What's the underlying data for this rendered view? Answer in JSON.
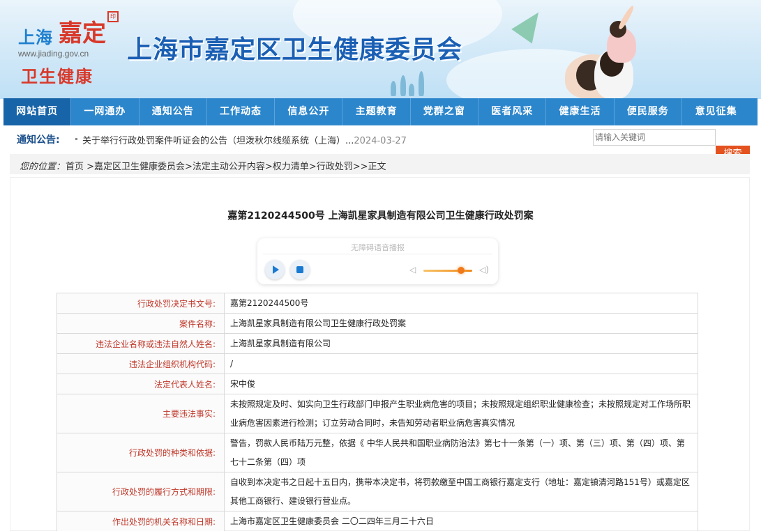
{
  "header": {
    "logo_shanghai": "上海",
    "logo_jiading": "嘉定",
    "logo_url": "www.jiading.gov.cn",
    "logo_health": "卫生健康",
    "site_title": "上海市嘉定区卫生健康委员会"
  },
  "nav": {
    "items": [
      "网站首页",
      "一网通办",
      "通知公告",
      "工作动态",
      "信息公开",
      "主题教育",
      "党群之窗",
      "医者风采",
      "健康生活",
      "便民服务",
      "意见征集"
    ],
    "active": "网站首页"
  },
  "notice": {
    "label": "通知公告:",
    "text": "关于举行行政处罚案件听证会的公告（坦泼秋尔线缆系统（上海）...",
    "date": "2024-03-27"
  },
  "search": {
    "placeholder": "请输入关键词",
    "button": "搜索"
  },
  "breadcrumb": {
    "prefix": "您的位置：",
    "path": "首页 >嘉定区卫生健康委员会>法定主动公开内容>权力清单>行政处罚>>正文"
  },
  "article": {
    "title": "嘉第2120244500号 上海凯星家具制造有限公司卫生健康行政处罚案"
  },
  "player": {
    "label": "无障碍语音播报"
  },
  "table": {
    "rows": [
      {
        "key": "行政处罚决定书文号:",
        "value": "嘉第2120244500号"
      },
      {
        "key": "案件名称:",
        "value": "上海凯星家具制造有限公司卫生健康行政处罚案"
      },
      {
        "key": "违法企业名称或违法自然人姓名:",
        "value": "上海凯星家具制造有限公司"
      },
      {
        "key": "违法企业组织机构代码:",
        "value": "/"
      },
      {
        "key": "法定代表人姓名:",
        "value": "宋中俊"
      },
      {
        "key": "主要违法事实:",
        "value": "未按照规定及时、如实向卫生行政部门申报产生职业病危害的项目；未按照规定组织职业健康检查；未按照规定对工作场所职业病危害因素进行检测；订立劳动合同时，未告知劳动者职业病危害真实情况"
      },
      {
        "key": "行政处罚的种类和依据:",
        "value": "警告，罚款人民币陆万元整，依据《 中华人民共和国职业病防治法》第七十一条第（一）项、第（三）项、第（四）项、第七十二条第（四）项"
      },
      {
        "key": "行政处罚的履行方式和期限:",
        "value": "自收到本决定书之日起十五日内，携带本决定书，将罚款缴至中国工商银行嘉定支行（地址：嘉定镇清河路151号）或嘉定区其他工商银行、建设银行营业点。"
      },
      {
        "key": "作出处罚的机关名称和日期:",
        "value": "上海市嘉定区卫生健康委员会 二〇二四年三月二十六日"
      }
    ]
  }
}
